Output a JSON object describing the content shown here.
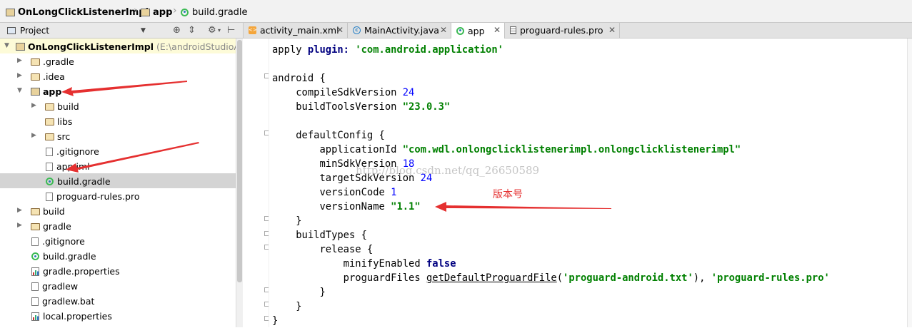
{
  "breadcrumb": {
    "items": [
      {
        "label": "OnLongClickListenerImpl",
        "icon": "module-folder-icon"
      },
      {
        "label": "app",
        "icon": "module-folder-icon"
      },
      {
        "label": "build.gradle",
        "icon": "gradle-icon"
      }
    ]
  },
  "project_panel": {
    "title": "Project",
    "tools": [
      "target-icon",
      "collapse-icon",
      "gear-icon",
      "hide-icon"
    ]
  },
  "tree": {
    "root_label": "OnLongClickListenerImpl",
    "root_path": "(E:\\androidStudioApp",
    "items": [
      {
        "label": ".gradle"
      },
      {
        "label": ".idea"
      },
      {
        "label": "app"
      },
      {
        "label": "build"
      },
      {
        "label": "libs"
      },
      {
        "label": "src"
      },
      {
        "label": ".gitignore"
      },
      {
        "label": "app.iml"
      },
      {
        "label": "build.gradle"
      },
      {
        "label": "proguard-rules.pro"
      },
      {
        "label": "build"
      },
      {
        "label": "gradle"
      },
      {
        "label": ".gitignore"
      },
      {
        "label": "build.gradle"
      },
      {
        "label": "gradle.properties"
      },
      {
        "label": "gradlew"
      },
      {
        "label": "gradlew.bat"
      },
      {
        "label": "local.properties"
      }
    ]
  },
  "tabs": [
    {
      "label": "activity_main.xml",
      "icon": "xml-file-icon",
      "active": false
    },
    {
      "label": "MainActivity.java",
      "icon": "java-class-icon",
      "active": false
    },
    {
      "label": "app",
      "icon": "gradle-icon",
      "active": true
    },
    {
      "label": "proguard-rules.pro",
      "icon": "text-file-icon",
      "active": false
    }
  ],
  "code": {
    "l1": {
      "a": "apply ",
      "b": "plugin:",
      "c": " ",
      "d": "'com.android.application'"
    },
    "l3": "android {",
    "l4": {
      "a": "    compileSdkVersion ",
      "b": "24"
    },
    "l5": {
      "a": "    buildToolsVersion ",
      "b": "\"23.0.3\""
    },
    "l7": "    defaultConfig {",
    "l8": {
      "a": "        applicationId ",
      "b": "\"com.wdl.onlongclicklistenerimpl.onlongclicklistenerimpl\""
    },
    "l9": {
      "a": "        minSdkVersion ",
      "b": "18"
    },
    "l10": {
      "a": "        targetSdkVersion ",
      "b": "24"
    },
    "l11": {
      "a": "        versionCode ",
      "b": "1"
    },
    "l12": {
      "a": "        versionName ",
      "b": "\"1.1\""
    },
    "l13": "    }",
    "l14": "    buildTypes {",
    "l15": "        release {",
    "l16": {
      "a": "            minifyEnabled ",
      "b": "false"
    },
    "l17": {
      "a": "            proguardFiles ",
      "b": "getDefaultProguardFile",
      "c": "(",
      "d": "'proguard-android.txt'",
      "e": "), ",
      "f": "'proguard-rules.pro'"
    },
    "l18": "        }",
    "l19": "    }",
    "l20": "}"
  },
  "watermark": "http://blog.csdn.net/qq_26650589",
  "annotation": "版本号",
  "colors": {
    "string": "#008000",
    "number": "#0000ff",
    "keyword": "#000080",
    "arrow": "#e53030"
  }
}
